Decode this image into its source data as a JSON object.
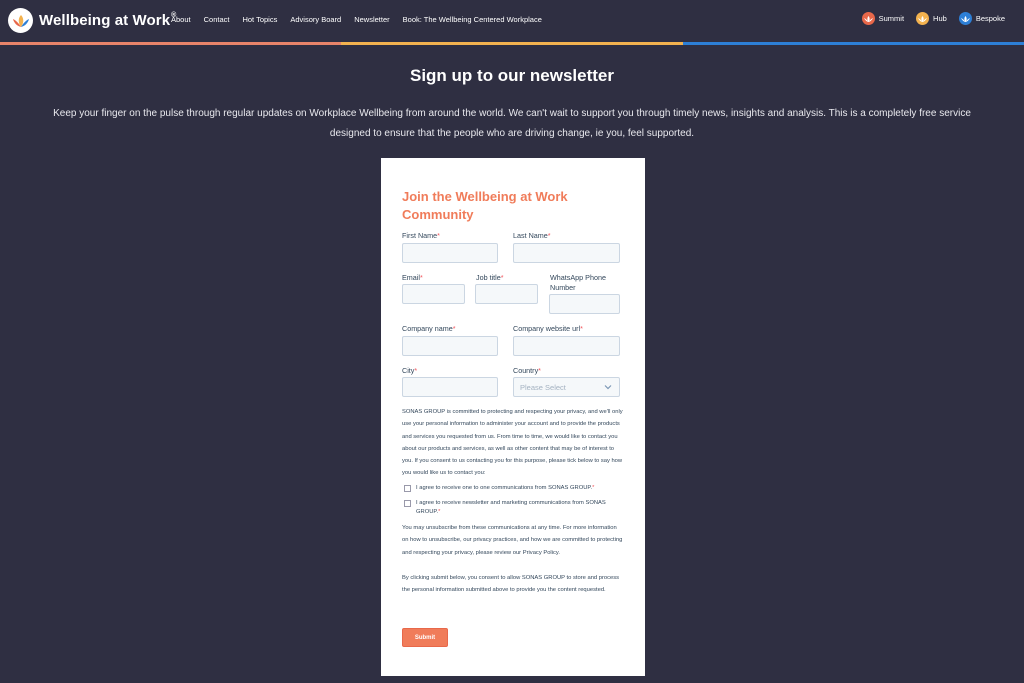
{
  "brand": {
    "name": "Wellbeing at Work",
    "reg": "®"
  },
  "nav": {
    "links": [
      "About",
      "Contact",
      "Hot Topics",
      "Advisory Board",
      "Newsletter",
      "Book: The Wellbeing Centered Workplace"
    ],
    "right": [
      {
        "label": "Summit",
        "color": "#e8684a"
      },
      {
        "label": "Hub",
        "color": "#f3b24f"
      },
      {
        "label": "Bespoke",
        "color": "#2d7fd6"
      }
    ]
  },
  "stripe_colors": [
    "#e8846a",
    "#f3b24f",
    "#2d7fd6"
  ],
  "hero": {
    "title": "Sign up to our newsletter",
    "description": "Keep your finger on the pulse through regular updates on Workplace Wellbeing from around the world. We can't wait to support you through timely news, insights and analysis. This is a completely free service designed to ensure that the people who are driving change, ie you, feel supported."
  },
  "form": {
    "title": "Join the Wellbeing at Work Community",
    "required_mark": "*",
    "fields": {
      "first_name": "First Name",
      "last_name": "Last Name",
      "email": "Email",
      "job_title": "Job title",
      "whatsapp": "WhatsApp Phone Number",
      "company_name": "Company name",
      "company_url": "Company website url",
      "city": "City",
      "country": "Country"
    },
    "country_placeholder": "Please Select",
    "privacy_intro": "SONAS GROUP is committed to protecting and respecting your privacy, and we'll only use your personal information to administer your account and to provide the products and services you requested from us. From time to time, we would like to contact you about our products and services, as well as other content that may be of interest to you. If you consent to us contacting you for this purpose, please tick below to say how you would like us to contact you:",
    "consent_one": "I agree to receive one to one communications from SONAS GROUP.",
    "consent_newsletter": "I agree to receive newsletter and marketing communications from SONAS GROUP.",
    "unsubscribe": "You may unsubscribe from these communications at any time. For more information on how to unsubscribe, our privacy practices, and how we are committed to protecting and respecting your privacy, please review our Privacy Policy.",
    "consent_store": "By clicking submit below, you consent to allow SONAS GROUP to store and process the personal information submitted above to provide you the content requested.",
    "submit_label": "Submit"
  }
}
